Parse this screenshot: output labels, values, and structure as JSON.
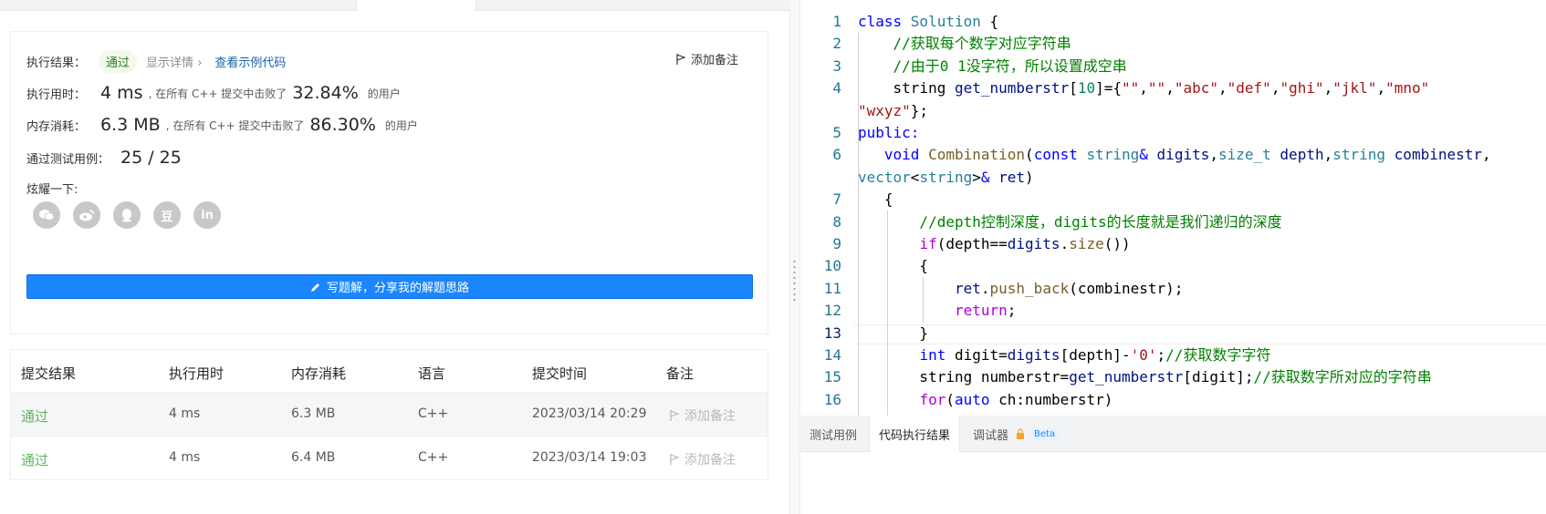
{
  "result": {
    "label": "执行结果：",
    "status": "通过",
    "details": "显示详情",
    "details_chevron": "›",
    "example_link": "查看示例代码",
    "add_note": "添加备注"
  },
  "runtime": {
    "label": "执行用时：",
    "value": "4 ms",
    "mid": ", 在所有 C++ 提交中击败了",
    "pct": "32.84%",
    "tail": "的用户"
  },
  "memory": {
    "label": "内存消耗：",
    "value": "6.3 MB",
    "mid": ", 在所有 C++ 提交中击败了",
    "pct": "86.30%",
    "tail": "的用户"
  },
  "tests": {
    "label": "通过测试用例：",
    "value": "25 / 25"
  },
  "share": {
    "label": "炫耀一下:",
    "icons": [
      "wechat-icon",
      "weibo-icon",
      "qq-icon",
      "douban-icon",
      "linkedin-icon"
    ],
    "douban_glyph": "豆",
    "linkedin_glyph": "in"
  },
  "write_button": "写题解，分享我的解题思路",
  "table": {
    "headers": [
      "提交结果",
      "执行用时",
      "内存消耗",
      "语言",
      "提交时间",
      "备注"
    ],
    "rows": [
      {
        "status": "通过",
        "time": "4 ms",
        "memory": "6.3 MB",
        "lang": "C++",
        "date": "2023/03/14 20:29",
        "note": "添加备注"
      },
      {
        "status": "通过",
        "time": "4 ms",
        "memory": "6.4 MB",
        "lang": "C++",
        "date": "2023/03/14 19:03",
        "note": "添加备注"
      }
    ]
  },
  "editor": {
    "active_line": "13",
    "lines": [
      {
        "n": "1",
        "tokens": [
          [
            "kw",
            "class "
          ],
          [
            "ty",
            "Solution"
          ],
          [
            "tx",
            " {"
          ]
        ]
      },
      {
        "n": "2",
        "tokens": [
          [
            "cm",
            "    //获取每个数字对应字符串"
          ]
        ]
      },
      {
        "n": "3",
        "tokens": [
          [
            "cm",
            "    //由于0 1没字符，所以设置成空串"
          ]
        ]
      },
      {
        "n": "4",
        "tokens": [
          [
            "tx",
            "    string "
          ],
          [
            "vr",
            "get_numberstr"
          ],
          [
            "tx",
            "["
          ],
          [
            "nm",
            "10"
          ],
          [
            "tx",
            "]={"
          ],
          [
            "st",
            "\"\""
          ],
          [
            "tx",
            ","
          ],
          [
            "st",
            "\"\""
          ],
          [
            "tx",
            ","
          ],
          [
            "st",
            "\"abc\""
          ],
          [
            "tx",
            ","
          ],
          [
            "st",
            "\"def\""
          ],
          [
            "tx",
            ","
          ],
          [
            "st",
            "\"ghi\""
          ],
          [
            "tx",
            ","
          ],
          [
            "st",
            "\"jkl\""
          ],
          [
            "tx",
            ","
          ],
          [
            "st",
            "\"mno\""
          ]
        ]
      },
      {
        "n": "",
        "tokens": [
          [
            "st",
            "\"wxyz\""
          ],
          [
            "tx",
            "};"
          ]
        ]
      },
      {
        "n": "5",
        "tokens": [
          [
            "kw",
            "public:"
          ]
        ]
      },
      {
        "n": "6",
        "tokens": [
          [
            "tx",
            "   "
          ],
          [
            "kw",
            "void "
          ],
          [
            "fn",
            "Combination"
          ],
          [
            "tx",
            "("
          ],
          [
            "kw",
            "const "
          ],
          [
            "ty",
            "string"
          ],
          [
            "kw",
            "& "
          ],
          [
            "vr",
            "digits"
          ],
          [
            "tx",
            ","
          ],
          [
            "ty",
            "size_t "
          ],
          [
            "vr",
            "depth"
          ],
          [
            "tx",
            ","
          ],
          [
            "ty",
            "string "
          ],
          [
            "vr",
            "combinestr"
          ],
          [
            "tx",
            ","
          ]
        ]
      },
      {
        "n": "",
        "tokens": [
          [
            "ty",
            "vector"
          ],
          [
            "tx",
            "<"
          ],
          [
            "ty",
            "string"
          ],
          [
            "tx",
            ">"
          ],
          [
            "kw",
            "& "
          ],
          [
            "vr",
            "ret"
          ],
          [
            "tx",
            ")"
          ]
        ]
      },
      {
        "n": "7",
        "tokens": [
          [
            "tx",
            "   {"
          ]
        ]
      },
      {
        "n": "8",
        "tokens": [
          [
            "cm",
            "       //depth控制深度，digits的长度就是我们递归的深度"
          ]
        ]
      },
      {
        "n": "9",
        "tokens": [
          [
            "tx",
            "       "
          ],
          [
            "ctl",
            "if"
          ],
          [
            "tx",
            "(depth=="
          ],
          [
            "vr",
            "digits"
          ],
          [
            "tx",
            "."
          ],
          [
            "fn",
            "size"
          ],
          [
            "tx",
            "())"
          ]
        ]
      },
      {
        "n": "10",
        "tokens": [
          [
            "tx",
            "       {"
          ]
        ]
      },
      {
        "n": "11",
        "tokens": [
          [
            "tx",
            "           "
          ],
          [
            "vr",
            "ret"
          ],
          [
            "tx",
            "."
          ],
          [
            "fn",
            "push_back"
          ],
          [
            "tx",
            "(combinestr);"
          ]
        ]
      },
      {
        "n": "12",
        "tokens": [
          [
            "tx",
            "           "
          ],
          [
            "ctl",
            "return"
          ],
          [
            "tx",
            ";"
          ]
        ]
      },
      {
        "n": "13",
        "tokens": [
          [
            "tx",
            "       }"
          ]
        ]
      },
      {
        "n": "14",
        "tokens": [
          [
            "tx",
            "       "
          ],
          [
            "kw",
            "int "
          ],
          [
            "tx",
            "digit="
          ],
          [
            "vr",
            "digits"
          ],
          [
            "tx",
            "[depth]-"
          ],
          [
            "st",
            "'0'"
          ],
          [
            "tx",
            ";"
          ],
          [
            "cm",
            "//获取数字字符"
          ]
        ]
      },
      {
        "n": "15",
        "tokens": [
          [
            "tx",
            "       string numberstr="
          ],
          [
            "vr",
            "get_numberstr"
          ],
          [
            "tx",
            "[digit];"
          ],
          [
            "cm",
            "//获取数字所对应的字符串"
          ]
        ]
      },
      {
        "n": "16",
        "tokens": [
          [
            "tx",
            "       "
          ],
          [
            "ctl",
            "for"
          ],
          [
            "tx",
            "("
          ],
          [
            "kw",
            "auto "
          ],
          [
            "tx",
            "ch:numberstr)"
          ]
        ]
      }
    ]
  },
  "bottom_tabs": {
    "tab1": "测试用例",
    "tab2": "代码执行结果",
    "tab3": "调试器",
    "beta": "Beta"
  },
  "colors": {
    "accent": "#1a86ff",
    "pass": "#5cb85c"
  }
}
